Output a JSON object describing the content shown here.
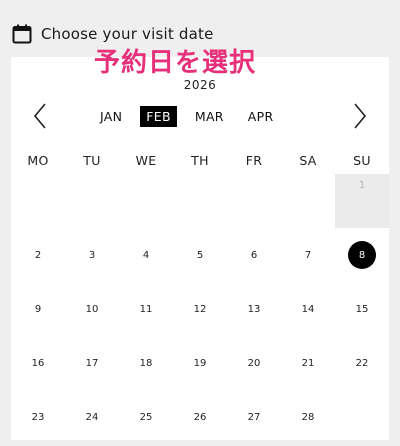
{
  "header": {
    "title": "Choose your visit date",
    "icon": "calendar-icon"
  },
  "overlay_text": "予約日を選択",
  "calendar": {
    "year": "2026",
    "months": [
      "JAN",
      "FEB",
      "MAR",
      "APR"
    ],
    "active_month": "FEB",
    "weekdays": [
      "MO",
      "TU",
      "WE",
      "TH",
      "FR",
      "SA",
      "SU"
    ],
    "weeks": [
      [
        "",
        "",
        "",
        "",
        "",
        "",
        "1"
      ],
      [
        "2",
        "3",
        "4",
        "5",
        "6",
        "7",
        "8"
      ],
      [
        "9",
        "10",
        "11",
        "12",
        "13",
        "14",
        "15"
      ],
      [
        "16",
        "17",
        "18",
        "19",
        "20",
        "21",
        "22"
      ],
      [
        "23",
        "24",
        "25",
        "26",
        "27",
        "28",
        ""
      ]
    ],
    "disabled_days": [
      "1"
    ],
    "selected_day": "8"
  },
  "colors": {
    "overlay": "#e8307a",
    "selected": "#000000",
    "background": "#efefef"
  }
}
